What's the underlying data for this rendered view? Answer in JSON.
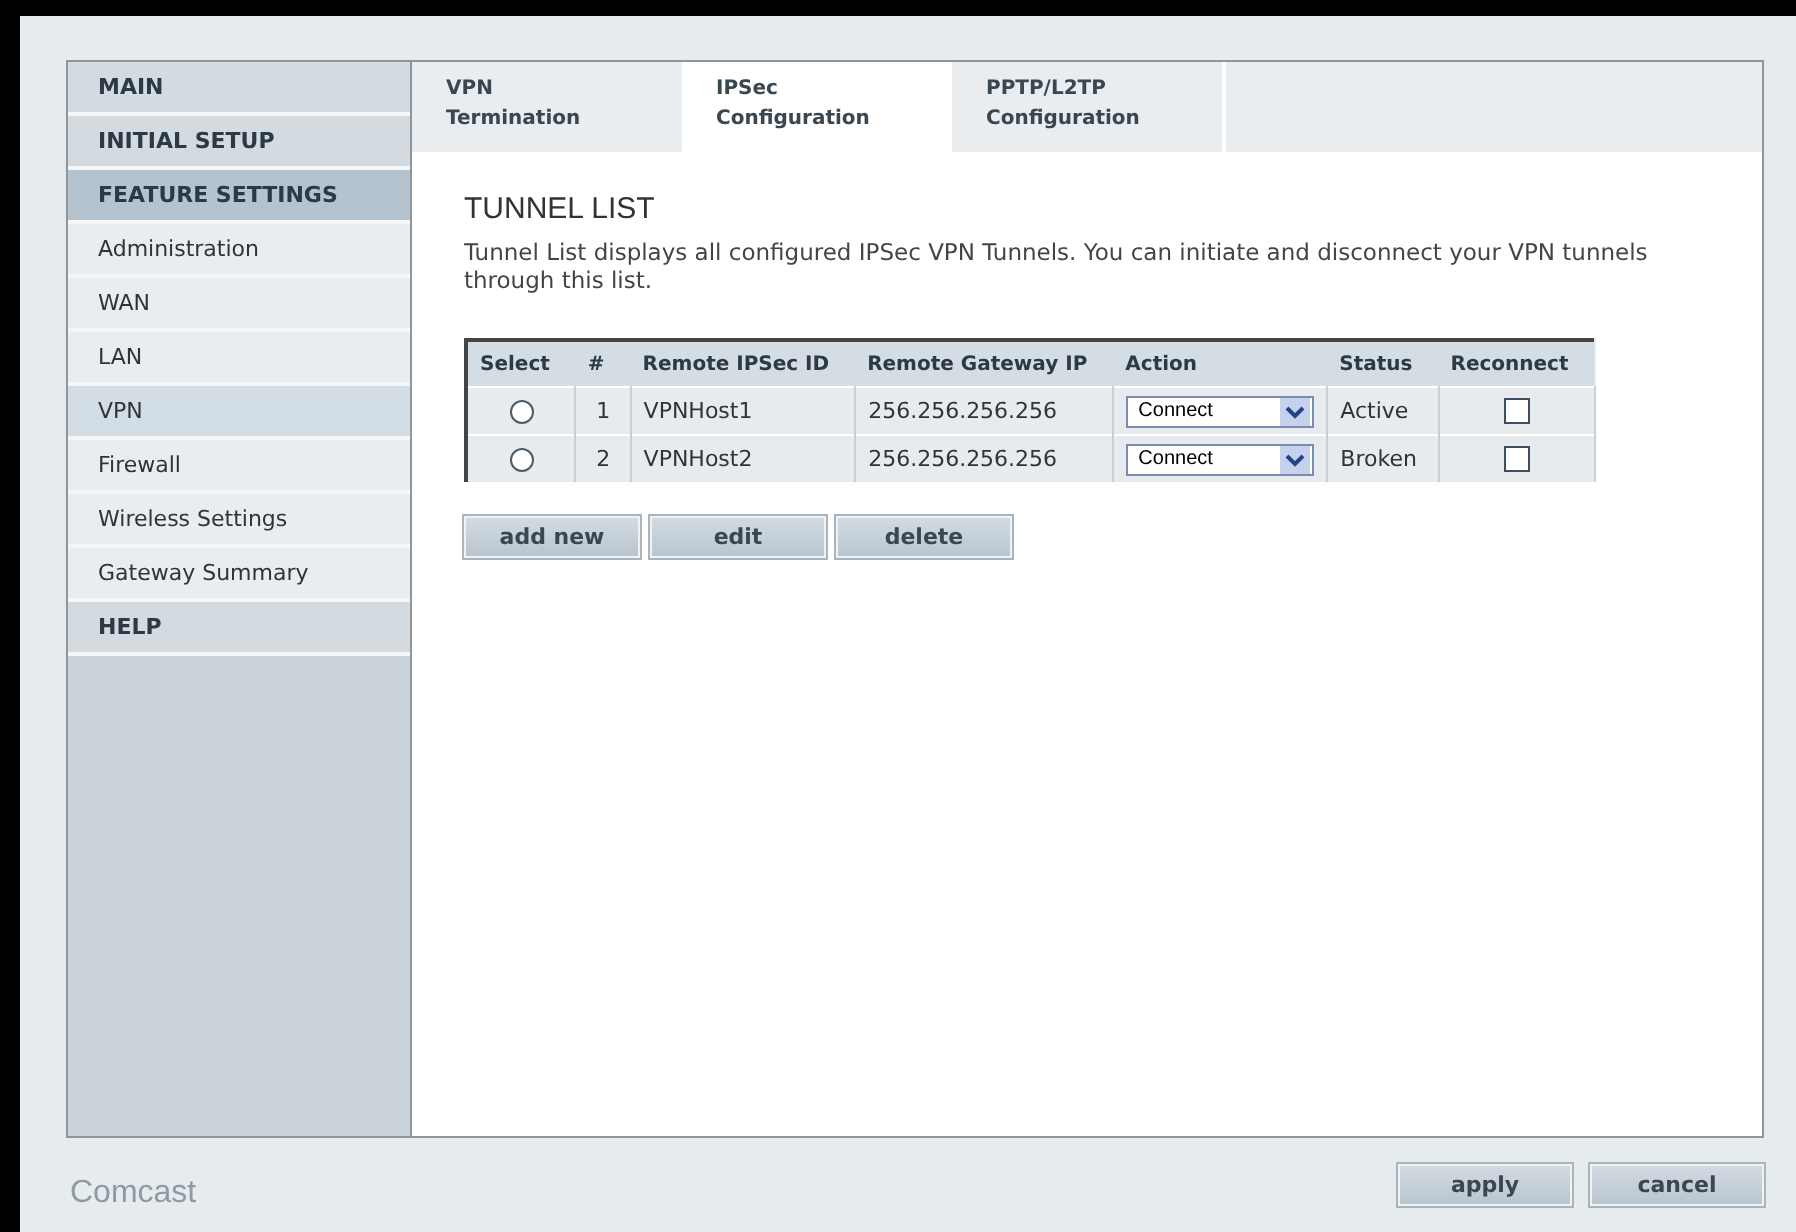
{
  "sidebar": {
    "items": [
      {
        "label": "MAIN",
        "kind": "header",
        "selected": false
      },
      {
        "label": "INITIAL SETUP",
        "kind": "header",
        "selected": false
      },
      {
        "label": "FEATURE SETTINGS",
        "kind": "header",
        "selected": true
      },
      {
        "label": "Administration",
        "kind": "item",
        "selected": false
      },
      {
        "label": "WAN",
        "kind": "item",
        "selected": false
      },
      {
        "label": "LAN",
        "kind": "item",
        "selected": false
      },
      {
        "label": "VPN",
        "kind": "item",
        "selected": true
      },
      {
        "label": "Firewall",
        "kind": "item",
        "selected": false
      },
      {
        "label": "Wireless Settings",
        "kind": "item",
        "selected": false
      },
      {
        "label": "Gateway Summary",
        "kind": "item",
        "selected": false
      },
      {
        "label": "HELP",
        "kind": "header",
        "selected": false
      }
    ]
  },
  "tabs": [
    {
      "line1": "VPN",
      "line2": "Termination",
      "selected": false
    },
    {
      "line1": "IPSec",
      "line2": "Configuration",
      "selected": true
    },
    {
      "line1": "PPTP/L2TP",
      "line2": "Configuration",
      "selected": false
    }
  ],
  "section": {
    "title": "TUNNEL LIST",
    "description": "Tunnel List displays all configured IPSec VPN Tunnels. You can initiate and disconnect your VPN tunnels through this list."
  },
  "table": {
    "columns": [
      "Select",
      "#",
      "Remote IPSec ID",
      "Remote Gateway IP",
      "Action",
      "Status",
      "Reconnect"
    ],
    "rows": [
      {
        "selected": false,
        "index": "1",
        "remote_id": "VPNHost1",
        "gateway_ip": "256.256.256.256",
        "action": "Connect",
        "status": "Active",
        "reconnect": false
      },
      {
        "selected": false,
        "index": "2",
        "remote_id": "VPNHost2",
        "gateway_ip": "256.256.256.256",
        "action": "Connect",
        "status": "Broken",
        "reconnect": false
      }
    ]
  },
  "table_buttons": [
    "add new",
    "edit",
    "delete"
  ],
  "footer": {
    "logo": "Comcast",
    "buttons": [
      "apply",
      "cancel"
    ]
  }
}
